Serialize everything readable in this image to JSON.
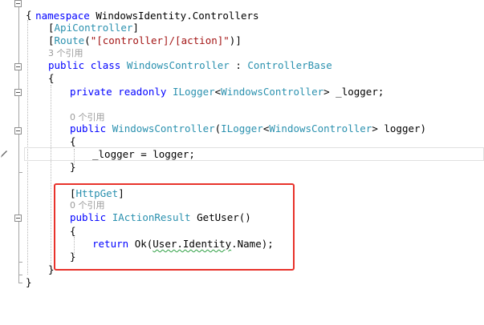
{
  "code": {
    "namespace_kw": "namespace",
    "namespace_name": "WindowsIdentity.Controllers",
    "open_brace": "{",
    "close_brace": "}",
    "attr_api_open": "[",
    "attr_api": "ApiController",
    "attr_api_close": "]",
    "attr_route_open": "[",
    "attr_route": "Route",
    "attr_route_paren": "(",
    "attr_route_str": "\"[controller]/[action]\"",
    "attr_route_close": ")]",
    "refs_class": "3 个引用",
    "kw_public": "public",
    "kw_class": "class",
    "class_name": "WindowsController",
    "colon": ":",
    "base_class": "ControllerBase",
    "kw_private": "private",
    "kw_readonly": "readonly",
    "ilogger": "ILogger",
    "lt": "<",
    "generic_arg": "WindowsController",
    "gt_field": "> _logger;",
    "refs_ctor": "0 个引用",
    "ctor_name": "WindowsController",
    "ctor_paren": "(",
    "gt_param": "> logger)",
    "assign_stmt": "_logger = logger;",
    "attr_get_open": "[",
    "attr_get": "HttpGet",
    "attr_get_close": "]",
    "refs_method": "0 个引用",
    "return_type": "IActionResult",
    "method_sig": "GetUser()",
    "kw_return": "return",
    "ok_call": "Ok(",
    "user_identity": "User.Identity",
    "name_tail": ".Name);"
  }
}
